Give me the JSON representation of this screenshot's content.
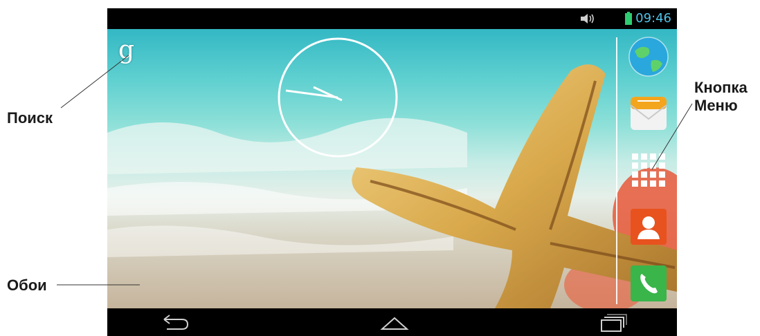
{
  "annotations": {
    "search": "Поиск",
    "wallpaper": "Обои",
    "menu_line1": "Кнопка",
    "menu_line2": "Меню"
  },
  "status_bar": {
    "time": "09:46",
    "icons": [
      "volume-icon",
      "battery-icon"
    ],
    "time_color": "#4fc3e8",
    "battery_color": "#2ecc71"
  },
  "home_screen": {
    "search_widget": "google-search-icon",
    "clock_widget": "analog-clock",
    "wallpaper": "starfish-beach"
  },
  "dock": {
    "items": [
      {
        "name": "browser-icon"
      },
      {
        "name": "messaging-icon"
      },
      {
        "name": "app-drawer-icon"
      },
      {
        "name": "contacts-icon"
      },
      {
        "name": "phone-icon"
      }
    ]
  },
  "nav_bar": {
    "buttons": [
      "back-icon",
      "home-icon",
      "recent-apps-icon"
    ]
  },
  "google_glyph": "g"
}
